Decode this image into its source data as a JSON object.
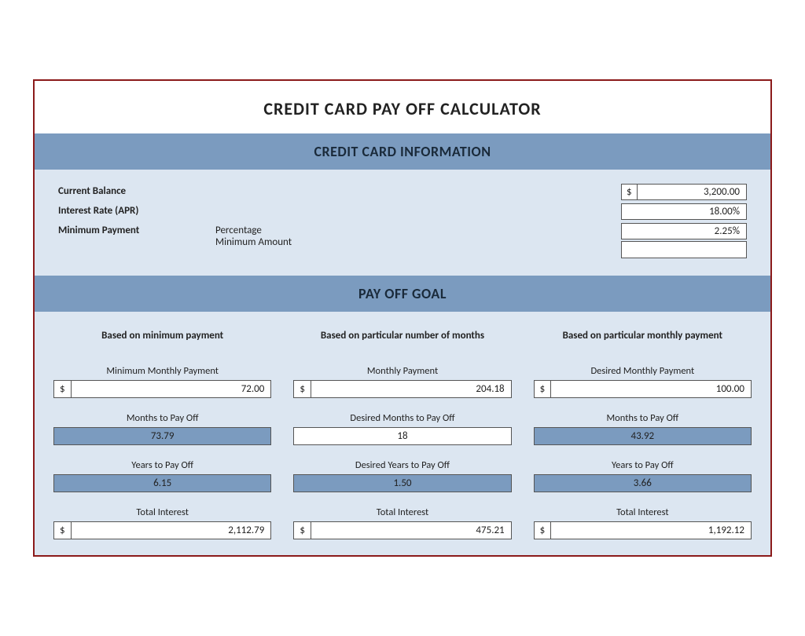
{
  "title": "CREDIT CARD PAY OFF CALCULATOR",
  "creditCardSection": {
    "header": "CREDIT CARD INFORMATION",
    "fields": [
      {
        "label": "Current Balance",
        "middle": "",
        "value": "3,200.00",
        "type": "dollar"
      },
      {
        "label": "Interest Rate (APR)",
        "middle": "",
        "value": "18.00%",
        "type": "pct"
      },
      {
        "label": "Minimum Payment",
        "middle_line1": "Percentage",
        "middle_line2": "Minimum Amount",
        "value": "2.25%",
        "type": "pct_empty"
      }
    ]
  },
  "payoffSection": {
    "header": "PAY OFF GOAL",
    "columns": [
      {
        "header": "Based on minimum payment",
        "fields": [
          {
            "label": "Minimum Monthly Payment",
            "dollar": true,
            "value": "72.00",
            "style": "white"
          },
          {
            "label": "Months to Pay Off",
            "dollar": false,
            "value": "73.79",
            "style": "blue"
          },
          {
            "label": "Years to Pay Off",
            "dollar": false,
            "value": "6.15",
            "style": "blue"
          },
          {
            "label": "Total Interest",
            "dollar": true,
            "value": "2,112.79",
            "style": "white"
          }
        ]
      },
      {
        "header": "Based on particular number of months",
        "fields": [
          {
            "label": "Monthly Payment",
            "dollar": true,
            "value": "204.18",
            "style": "white"
          },
          {
            "label": "Desired Months to Pay Off",
            "dollar": false,
            "value": "18",
            "style": "white"
          },
          {
            "label": "Desired Years to Pay Off",
            "dollar": false,
            "value": "1.50",
            "style": "blue"
          },
          {
            "label": "Total Interest",
            "dollar": true,
            "value": "475.21",
            "style": "white"
          }
        ]
      },
      {
        "header": "Based on particular monthly payment",
        "fields": [
          {
            "label": "Desired Monthly Payment",
            "dollar": true,
            "value": "100.00",
            "style": "white"
          },
          {
            "label": "Months to Pay Off",
            "dollar": false,
            "value": "43.92",
            "style": "blue"
          },
          {
            "label": "Years to Pay Off",
            "dollar": false,
            "value": "3.66",
            "style": "blue"
          },
          {
            "label": "Total Interest",
            "dollar": true,
            "value": "1,192.12",
            "style": "white"
          }
        ]
      }
    ]
  }
}
